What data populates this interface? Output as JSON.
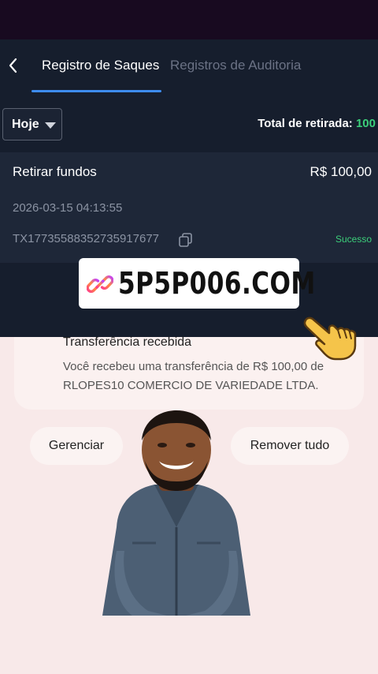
{
  "header": {
    "tab_active": "Registro de Saques",
    "tab_inactive": "Registros de Auditoria"
  },
  "filter": {
    "selected": "Hoje",
    "total_label": "Total de retirada:",
    "total_value": "100"
  },
  "transaction": {
    "title": "Retirar fundos",
    "amount": "R$ 100,00",
    "datetime": "2026-03-15 04:13:55",
    "tx_id": "TX17735588352735917677",
    "status": "Sucesso"
  },
  "watermark": {
    "text": "5P5P006.COM"
  },
  "notification": {
    "title": "Transferência recebida",
    "body": "Você recebeu uma transferência de R$ 100,00 de RLOPES10 COMERCIO DE VARIEDADE LTDA."
  },
  "actions": {
    "manage": "Gerenciar",
    "remove_all": "Remover tudo"
  },
  "colors": {
    "dark_bg": "#161e2d",
    "accent_blue": "#3d8cf0",
    "success_green": "#3ccf7a",
    "pink_bg": "#f8e9e9"
  },
  "icons": [
    "back-arrow-icon",
    "dropdown-caret-icon",
    "copy-icon",
    "link-icon",
    "pointing-hand-icon"
  ]
}
